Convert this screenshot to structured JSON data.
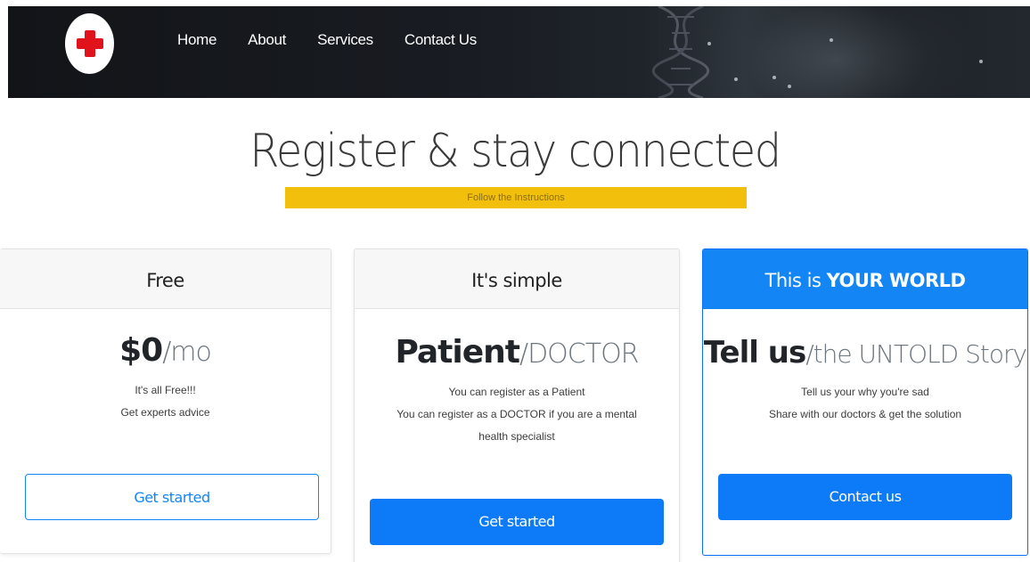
{
  "nav": {
    "links": [
      "Home",
      "About",
      "Services",
      "Contact Us"
    ]
  },
  "hero": {
    "title": "Register & stay connected",
    "subtitle": "Follow the Instructions"
  },
  "cards": [
    {
      "header": "Free",
      "price_main": "$0",
      "price_suffix": "/mo",
      "lines": [
        "It's all Free!!!",
        "Get experts advice"
      ],
      "button": "Get started"
    },
    {
      "header": "It's simple",
      "price_main": "Patient",
      "price_suffix": "/DOCTOR",
      "lines": [
        "You can register as a Patient",
        "You can register as a DOCTOR if you are a mental health specialist"
      ],
      "button": "Get started"
    },
    {
      "header_prefix": "This is ",
      "header_strong": "YOUR WORLD",
      "price_main": "Tell us",
      "price_suffix": "/the UNTOLD Story",
      "lines": [
        "Tell us your why you're sad",
        "Share with our doctors & get the solution"
      ],
      "button": "Contact us"
    }
  ],
  "colors": {
    "accent": "#0d7bf7",
    "highlight": "#f3bf0d",
    "logo_cross": "#e0121b"
  }
}
